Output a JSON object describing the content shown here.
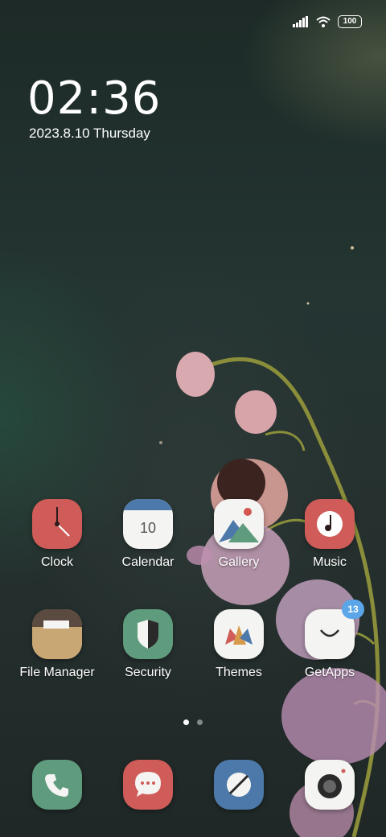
{
  "status": {
    "battery": "100"
  },
  "lockclock": {
    "time": "02:36",
    "date": "2023.8.10 Thursday"
  },
  "apps": [
    {
      "label": "Clock",
      "icon": "clock-icon"
    },
    {
      "label": "Calendar",
      "icon": "calendar-icon",
      "day": "10"
    },
    {
      "label": "Gallery",
      "icon": "gallery-icon"
    },
    {
      "label": "Music",
      "icon": "music-icon"
    },
    {
      "label": "File Manager",
      "icon": "folder-icon"
    },
    {
      "label": "Security",
      "icon": "shield-icon"
    },
    {
      "label": "Themes",
      "icon": "themes-icon"
    },
    {
      "label": "GetApps",
      "icon": "getapps-icon",
      "badge": "13"
    }
  ],
  "dock": [
    {
      "icon": "phone-icon"
    },
    {
      "icon": "messages-icon"
    },
    {
      "icon": "browser-icon"
    },
    {
      "icon": "camera-icon"
    }
  ],
  "colors": {
    "red": "#cf5c58",
    "green": "#5f9c7e",
    "blue": "#4d79aa",
    "tan": "#c8a774"
  }
}
